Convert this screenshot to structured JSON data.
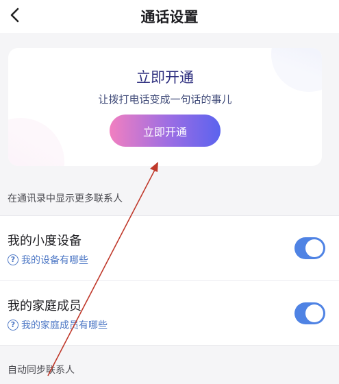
{
  "header": {
    "title": "通话设置",
    "back_icon": "chevron-left-icon"
  },
  "promo": {
    "title": "立即开通",
    "subtitle": "让拨打电话变成一句话的事儿",
    "button_label": "立即开通",
    "button_gradient": [
      "#f17fc0",
      "#9a6de4",
      "#5b63ee"
    ]
  },
  "sections": {
    "contacts_caption": "在通讯录中显示更多联系人",
    "sync_caption": "自动同步联系人"
  },
  "settings": [
    {
      "title": "我的小度设备",
      "help": "我的设备有哪些",
      "enabled": true
    },
    {
      "title": "我的家庭成员",
      "help": "我的家庭成员有哪些",
      "enabled": true
    }
  ],
  "colors": {
    "accent": "#4f83e4",
    "link": "#4f79c6",
    "annotation_arrow": "#c0392b"
  }
}
